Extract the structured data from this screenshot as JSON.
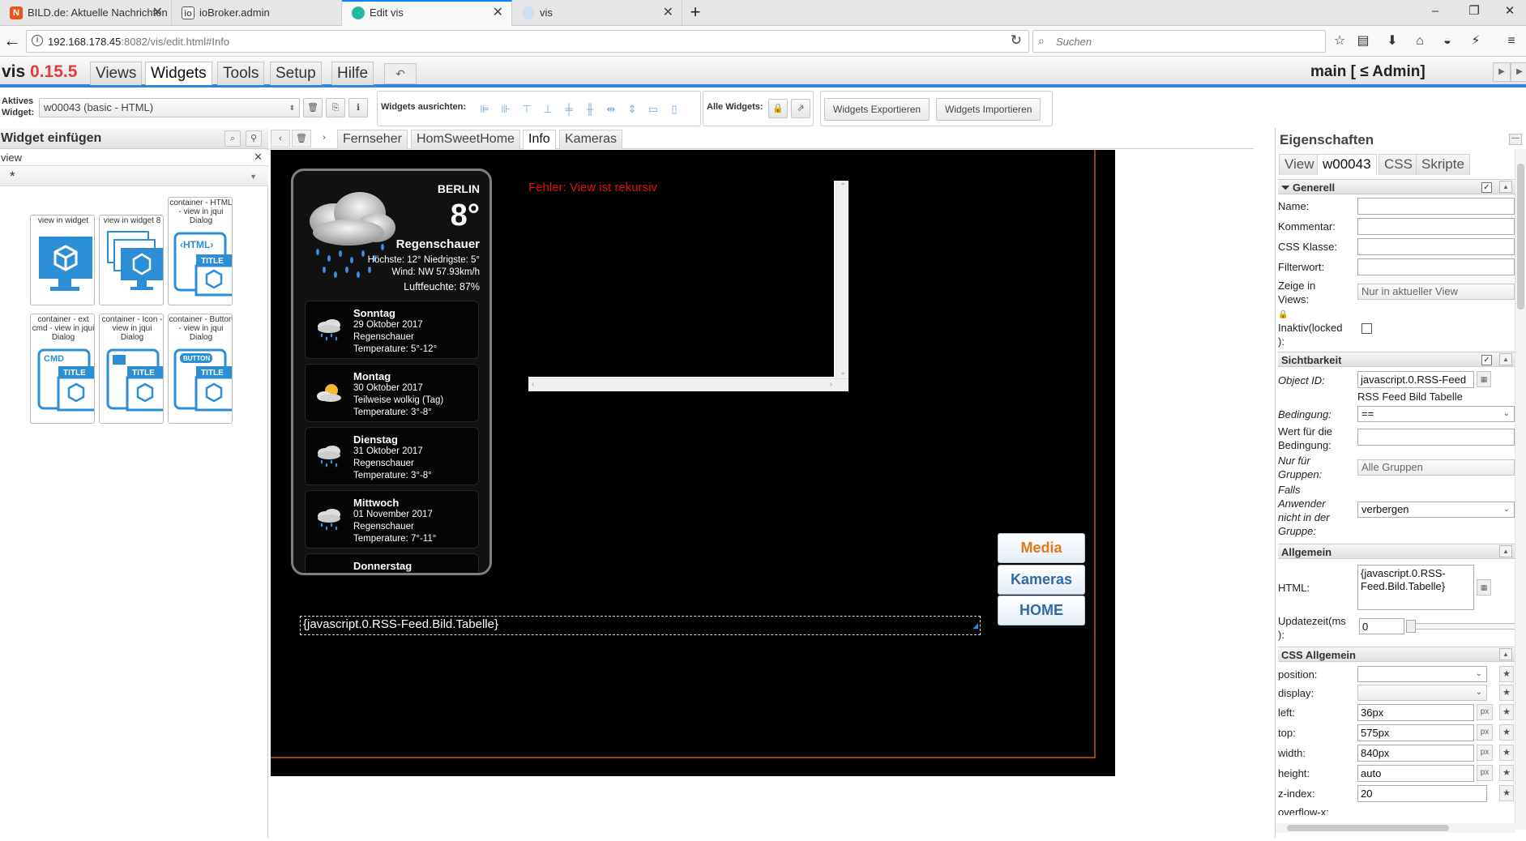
{
  "browser": {
    "tabs": [
      {
        "title": "BILD.de: Aktuelle Nachrichten",
        "favicon": "N",
        "favicon_color": "#e8531f"
      },
      {
        "title": "ioBroker.admin",
        "favicon": "io",
        "favicon_color": "#555555"
      },
      {
        "title": "Edit vis",
        "favicon": "v",
        "favicon_color": "#23b9a1"
      },
      {
        "title": "vis",
        "favicon": "v",
        "favicon_color": "#8ab0d8"
      }
    ],
    "url_host": "192.168.178.45",
    "url_rest": ":8082/vis/edit.html#Info",
    "search_placeholder": "Suchen"
  },
  "app": {
    "name": "vis",
    "version": "0.15.5",
    "menu": [
      "Views",
      "Widgets",
      "Tools",
      "Setup",
      "Hilfe"
    ],
    "active_menu": "Widgets",
    "project_user": "main [ ≤ Admin]"
  },
  "toolbar": {
    "active_widget_label_1": "Aktives",
    "active_widget_label_2": "Widget:",
    "active_widget_value": "w00043 (basic - HTML)",
    "align_label": "Widgets ausrichten:",
    "all_widgets_label": "Alle Widgets:",
    "export_label": "Widgets Exportieren",
    "import_label": "Widgets Importieren"
  },
  "left_panel": {
    "title": "Widget einfügen",
    "filter_value": "view",
    "set_value": "*",
    "widgets": [
      {
        "label": "view in widget"
      },
      {
        "label": "view in widget 8"
      },
      {
        "label": "container - HTML - view in jqui Dialog"
      },
      {
        "label": "container - ext cmd - view in jqui Dialog"
      },
      {
        "label": "container - Icon - view in jqui Dialog"
      },
      {
        "label": "container - Button - view in jqui Dialog"
      }
    ]
  },
  "views": {
    "tabs": [
      "Fernseher",
      "HomSweetHome",
      "Info",
      "Kameras"
    ],
    "active": "Info"
  },
  "canvas": {
    "weather": {
      "city": "BERLIN",
      "temp": "8°",
      "condition": "Regenschauer",
      "hilo": "Höchste: 12° Niedrigste: 5°",
      "wind": "Wind: NW 57.93km/h",
      "humidity": "Luftfeuchte: 87%",
      "days": [
        {
          "name": "Sonntag",
          "date": "29 Oktober 2017",
          "cond": "Regenschauer",
          "temp": "Temperature: 5°-12°",
          "icon": "rain-cloud-icon"
        },
        {
          "name": "Montag",
          "date": "30 Oktober 2017",
          "cond": "Teilweise wolkig (Tag)",
          "temp": "Temperature: 3°-8°",
          "icon": "partly-cloudy-icon"
        },
        {
          "name": "Dienstag",
          "date": "31 Oktober 2017",
          "cond": "Regenschauer",
          "temp": "Temperature: 3°-8°",
          "icon": "rain-cloud-icon"
        },
        {
          "name": "Mittwoch",
          "date": "01 November 2017",
          "cond": "Regenschauer",
          "temp": "Temperature: 7°-11°",
          "icon": "rain-cloud-icon"
        },
        {
          "name": "Donnerstag",
          "date": "",
          "cond": "",
          "temp": "",
          "icon": "rain-cloud-icon"
        }
      ]
    },
    "error_text": "Fehler: View ist rekursiv",
    "html_widget_text": "{javascript.0.RSS-Feed.Bild.Tabelle}",
    "nav_buttons": [
      {
        "label": "Media",
        "color": "#e07a1a"
      },
      {
        "label": "Kameras",
        "color": "#2f6aa8"
      },
      {
        "label": "HOME",
        "color": "#2f6aa8"
      }
    ]
  },
  "props": {
    "title": "Eigenschaften",
    "tabs": [
      "View",
      "w00043",
      "CSS",
      "Skripte"
    ],
    "active_tab": "w00043",
    "sections": {
      "general": "Generell",
      "visibility": "Sichtbarkeit",
      "common": "Allgemein",
      "css_common": "CSS Allgemein"
    },
    "general": {
      "name_label": "Name:",
      "comment_label": "Kommentar:",
      "css_class_label": "CSS Klasse:",
      "filter_label": "Filterwort:",
      "show_views_label_1": "Zeige in",
      "show_views_label_2": "Views:",
      "show_views_value": "Nur in aktueller View",
      "inactive_label_1": "Inaktiv(locked",
      "inactive_label_2": "):"
    },
    "visibility": {
      "oid_label": "Object ID:",
      "oid_value": "javascript.0.RSS-Feed",
      "oid_desc": "RSS Feed Bild Tabelle",
      "cond_label": "Bedingung:",
      "cond_value": "==",
      "cond_value_label_1": "Wert für die",
      "cond_value_label_2": "Bedingung:",
      "groups_label_1": "Nur für",
      "groups_label_2": "Gruppen:",
      "groups_value": "Alle Gruppen",
      "notin_label_1": "Falls",
      "notin_label_2": "Anwender",
      "notin_label_3": "nicht in der",
      "notin_label_4": "Gruppe:",
      "notin_value": "verbergen"
    },
    "common": {
      "html_label": "HTML:",
      "html_value_1": "{javascript.0.RSS-",
      "html_value_2": "Feed.Bild.Tabelle}",
      "update_label_1": "Updatezeit(ms",
      "update_label_2": "):",
      "update_value": "0"
    },
    "css": {
      "position_label": "position:",
      "position_value": "",
      "display_label": "display:",
      "display_value": "",
      "left_label": "left:",
      "left_value": "36px",
      "top_label": "top:",
      "top_value": "575px",
      "width_label": "width:",
      "width_value": "840px",
      "height_label": "height:",
      "height_value": "auto",
      "zindex_label": "z-index:",
      "zindex_value": "20",
      "overflow_label": "overflow-x:",
      "px": "px"
    }
  }
}
